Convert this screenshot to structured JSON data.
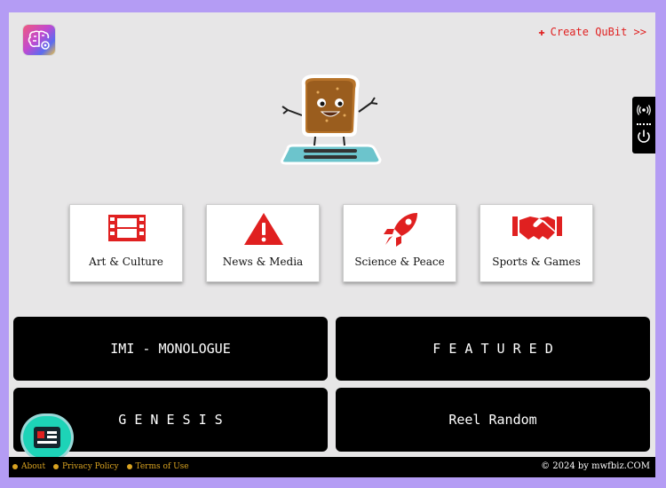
{
  "header": {
    "create_link": "Create QuBit >>",
    "create_icon": "✚"
  },
  "categories": [
    {
      "label": "Art & Culture",
      "icon": "film-icon"
    },
    {
      "label": "News & Media",
      "icon": "warning-icon"
    },
    {
      "label": "Science & Peace",
      "icon": "rocket-icon"
    },
    {
      "label": "Sports & Games",
      "icon": "handshake-icon"
    }
  ],
  "sections": [
    {
      "label": "IMI - MONOLOGUE"
    },
    {
      "label": "F E A T U R E D"
    },
    {
      "label": "G E N E S I S"
    },
    {
      "label": "Reel Random"
    }
  ],
  "footer": {
    "links": [
      "About",
      "Privacy Policy",
      "Terms of Use"
    ],
    "copyright": "© 2024 by mwfbiz.COM"
  },
  "colors": {
    "accent_red": "#e02020",
    "page_bg": "#b49cf4",
    "panel_bg": "#e7e6e7",
    "footer_link": "#d9a321",
    "fab": "#1dd3b7"
  }
}
